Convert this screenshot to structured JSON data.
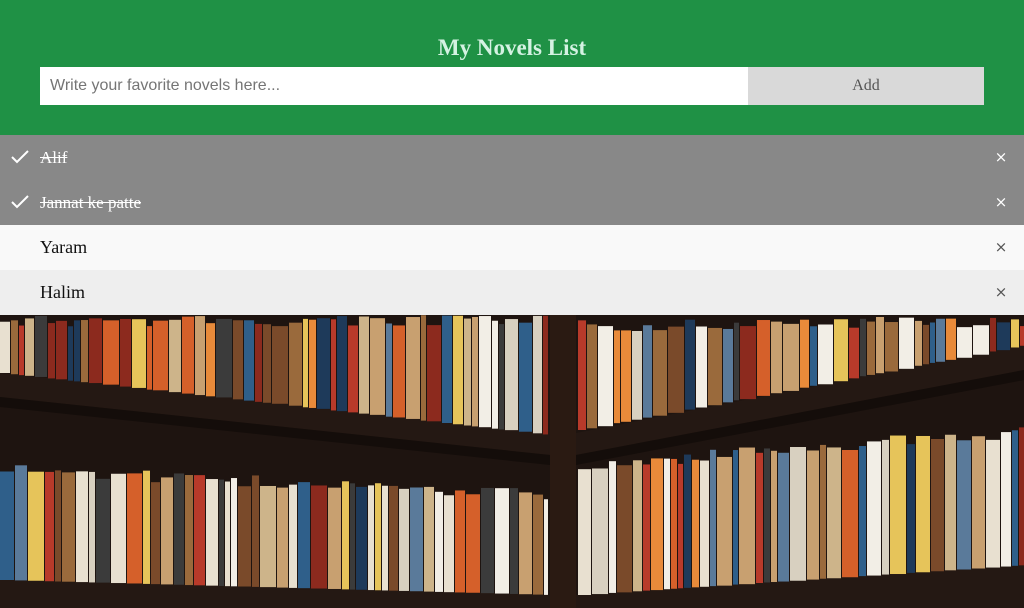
{
  "header": {
    "title": "My Novels List",
    "input_placeholder": "Write your favorite novels here...",
    "add_label": "Add"
  },
  "list": {
    "items": [
      {
        "label": "Alif",
        "checked": true
      },
      {
        "label": "Jannat ke patte",
        "checked": true
      },
      {
        "label": "Yaram",
        "checked": false
      },
      {
        "label": "Halim",
        "checked": false
      }
    ],
    "close_glyph": "×"
  },
  "colors": {
    "header_bg": "#1f9145",
    "title": "#d4f2e2",
    "checked_bg": "#888888",
    "row_light": "#f9f9f9",
    "row_alt": "#eeeeee",
    "add_button_bg": "#d9d9d9"
  },
  "background": {
    "icon": "bookshelf-photo"
  }
}
